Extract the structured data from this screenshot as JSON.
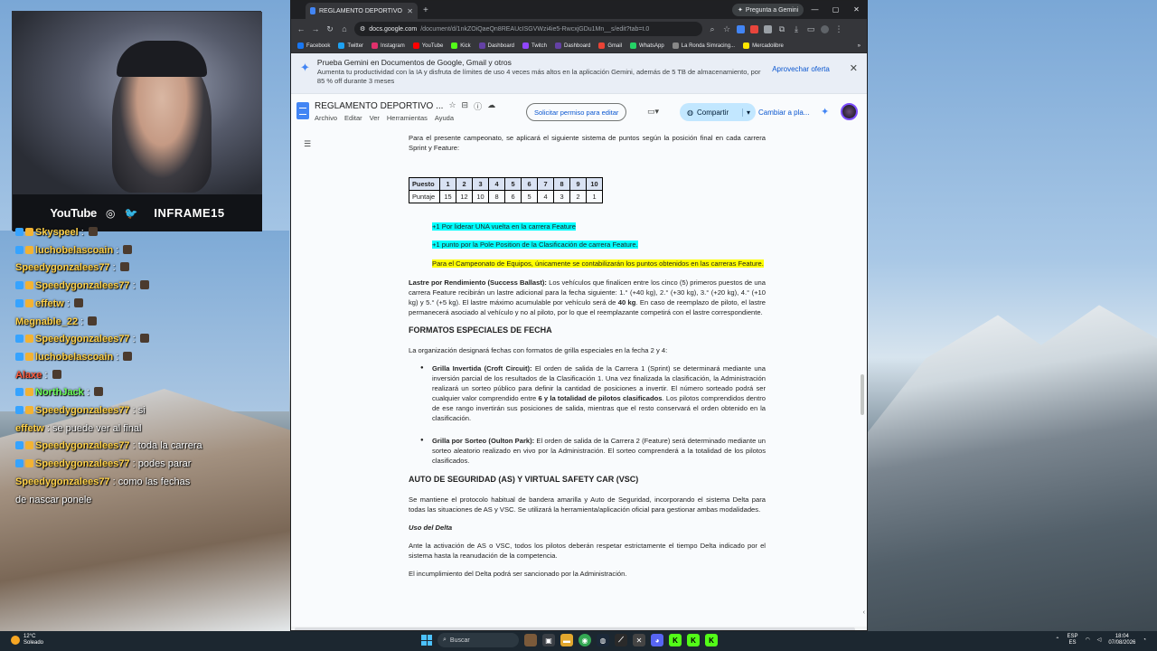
{
  "browser": {
    "tab_title": "REGLAMENTO DEPORTIVO BTC",
    "gemini_button": "Pregunta a Gemini",
    "url_host": "docs.google.com",
    "url_path": "/document/d/1nkZOiQaeQn8REAUcISGVWzi4ie5-RwcxjGDu1Mn__s/edit?tab=t.0",
    "bookmarks": [
      {
        "label": "Facebook",
        "color": "#1877f2"
      },
      {
        "label": "Twitter",
        "color": "#1da1f2"
      },
      {
        "label": "Instagram",
        "color": "#e1306c"
      },
      {
        "label": "YouTube",
        "color": "#ff0000"
      },
      {
        "label": "Kick",
        "color": "#53fc18"
      },
      {
        "label": "Dashboard",
        "color": "#6441a5"
      },
      {
        "label": "Twitch",
        "color": "#9146ff"
      },
      {
        "label": "Dashboard",
        "color": "#6441a5"
      },
      {
        "label": "Gmail",
        "color": "#ea4335"
      },
      {
        "label": "WhatsApp",
        "color": "#25d366"
      },
      {
        "label": "La Ronda Simracing...",
        "color": "#888888"
      },
      {
        "label": "Mercadolibre",
        "color": "#ffe600"
      }
    ]
  },
  "promo": {
    "title": "Prueba Gemini en Documentos de Google, Gmail y otros",
    "body": "Aumenta tu productividad con la IA y disfruta de límites de uso 4 veces más altos en la aplicación Gemini, además de 5 TB de almacenamiento, por 85 % off durante 3 meses",
    "offer": "Aprovechar oferta"
  },
  "doc": {
    "title": "REGLAMENTO DEPORTIVO ...",
    "menu": [
      "Archivo",
      "Editar",
      "Ver",
      "Herramientas",
      "Ayuda"
    ],
    "request_edit": "Solicitar permiso para editar",
    "share": "Compartir",
    "change": "Cambiar a pla..."
  },
  "content": {
    "intro": "Para el presente campeonato, se aplicará el siguiente sistema de puntos según la posición final en cada carrera Sprint y Feature:",
    "table": {
      "header": [
        "Puesto",
        "1",
        "2",
        "3",
        "4",
        "5",
        "6",
        "7",
        "8",
        "9",
        "10"
      ],
      "row": [
        "Puntaje",
        "15",
        "12",
        "10",
        "8",
        "6",
        "5",
        "4",
        "3",
        "2",
        "1"
      ]
    },
    "bonus1": "+1 Por liderar UNA vuelta en la carrera Feature",
    "bonus2": "+1 punto por la Pole Position de la Clasificación de carrera Feature.",
    "teams": "Para el Campeonato de Equipos, únicamente se contabilizarán los puntos obtenidos en las carreras Feature.",
    "ballast_label": "Lastre por Rendimiento (Success Ballast):",
    "ballast_text": " Los vehículos que finalicen entre los cinco (5) primeros puestos de una carrera Feature recibirán un lastre adicional para la fecha siguiente: 1.° (+40 kg), 2.° (+30 kg), 3.° (+20 kg), 4.° (+10 kg) y 5.° (+5 kg). El lastre máximo acumulable por vehículo será de ",
    "ballast_max": "40 kg",
    "ballast_text2": ". En caso de reemplazo de piloto, el lastre permanecerá asociado al vehículo y no al piloto, por lo que el reemplazante competirá con el lastre correspondiente.",
    "h_formats": "FORMATOS ESPECIALES DE FECHA",
    "formats_intro": "La organización designará fechas con formatos de grilla especiales en la fecha 2 y 4:",
    "grilla_inv_label": "Grilla Invertida (Croft Circuit):",
    "grilla_inv_text": " El orden de salida de la Carrera 1 (Sprint) se determinará mediante una inversión parcial de los resultados de la Clasificación 1. Una vez finalizada la clasificación, la Administración realizará un sorteo público para definir la cantidad de posiciones a invertir. El número sorteado podrá ser cualquier valor comprendido entre ",
    "grilla_inv_bold": "6 y la totalidad de pilotos clasificados",
    "grilla_inv_text2": ". Los pilotos comprendidos dentro de ese rango invertirán sus posiciones de salida, mientras que el resto conservará el orden obtenido en la clasificación.",
    "grilla_sorteo_label": "Grilla por Sorteo (Oulton Park):",
    "grilla_sorteo_text": " El orden de salida de la Carrera 2 (Feature) será determinado mediante un sorteo aleatorio realizado en vivo por la Administración. El sorteo comprenderá a la totalidad de los pilotos clasificados.",
    "h_safety": "AUTO DE SEGURIDAD (AS) Y VIRTUAL SAFETY CAR (VSC)",
    "safety_text": "Se mantiene el protocolo habitual de bandera amarilla y Auto de Seguridad, incorporando el sistema Delta para todas las situaciones de AS y VSC. Se utilizará la herramienta/aplicación oficial para gestionar ambas modalidades.",
    "h_delta": "Uso del Delta",
    "delta_text": "Ante la activación de AS o VSC, todos los pilotos deberán respetar estrictamente el tiempo Delta indicado por el sistema hasta la reanudación de la competencia.",
    "delta_penalty": "El incumplimiento del Delta podrá ser sancionado por la Administración."
  },
  "stream": {
    "platform": "YouTube",
    "handle": "INFRAME15"
  },
  "chat": [
    {
      "user": "Skyspeel",
      "color": "#ffd24a",
      "msg": ""
    },
    {
      "user": "luchobelascoain",
      "color": "#ffd24a",
      "msg": ""
    },
    {
      "user": "Speedygonzalees77",
      "color": "#ffd24a",
      "msg": ""
    },
    {
      "user": "Speedygonzalees77",
      "color": "#ffd24a",
      "msg": ""
    },
    {
      "user": "effetw",
      "color": "#ffd24a",
      "msg": ""
    },
    {
      "user": "Megnable_22",
      "color": "#ffd24a",
      "msg": ""
    },
    {
      "user": "Speedygonzalees77",
      "color": "#ffd24a",
      "msg": ""
    },
    {
      "user": "luchobelascoain",
      "color": "#ffd24a",
      "msg": ""
    },
    {
      "user": "Alaxe",
      "color": "#ff5a3c",
      "msg": ""
    },
    {
      "user": "NorthJack",
      "color": "#6cff5a",
      "msg": ""
    },
    {
      "user": "Speedygonzalees77",
      "color": "#ffd24a",
      "msg": "si"
    },
    {
      "user": "effetw",
      "color": "#ffd24a",
      "msg": "se puede ver al final"
    },
    {
      "user": "Speedygonzalees77",
      "color": "#ffd24a",
      "msg": "toda la carrera"
    },
    {
      "user": "Speedygonzalees77",
      "color": "#ffd24a",
      "msg": "podes parar"
    },
    {
      "user": "Speedygonzalees77",
      "color": "#ffd24a",
      "msg": "como las fechas"
    },
    {
      "user": "",
      "color": "#ffffff",
      "msg": "de nascar ponele"
    }
  ],
  "taskbar": {
    "temp": "12°C",
    "weather": "Soleado",
    "search": "Buscar",
    "lang": "ESP",
    "lang2": "ES",
    "time": "18:04",
    "date": "07/08/2026"
  }
}
